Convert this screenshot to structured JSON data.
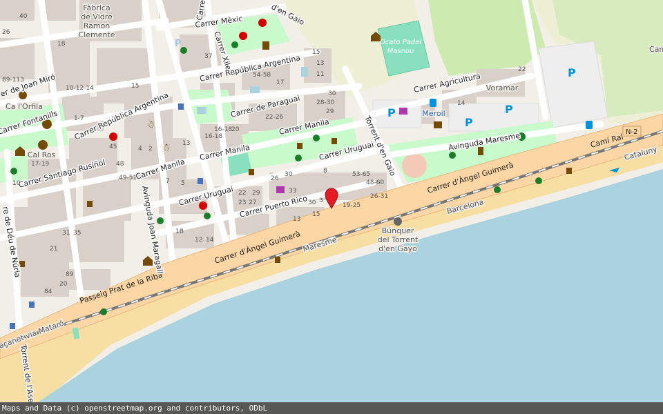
{
  "map": {
    "streets": {
      "carrer_mexic": "Carrer Mèxic",
      "carrer_xile_top": "Carrer Xile",
      "carrer_xile": "Carrer Xile",
      "carrer_rep_arg_top": "Carrer República Argentina",
      "carrer_rep_arg_left": "Carrer República Argentina",
      "carrer_paraguai": "Carrer de Paraguai",
      "carrer_manila_right": "Carrer Manila",
      "carrer_manila_mid": "Carrer Manila",
      "carrer_manila_left": "Carrer Manila",
      "carrer_uruguai_right": "Carrer Uruguai",
      "carrer_uruguai_left": "Carrer Uruguai",
      "carrer_puerto_rico": "Carrer Puerto Rico",
      "carrer_agricultura": "Carrer Agricultura",
      "avinguda_maresme": "Avinguda Maresme",
      "torrent_den_gaio": "Torrent d'en Gaio",
      "torrent_den_gaio_top": "d'en Gaio",
      "carrer_angel_guimera_right": "Carrer d'Àngel Guimerà",
      "carrer_angel_guimera_left": "Carrer d'Àngel Guimerà",
      "cami_ral": "Camí Ral",
      "passeig_prat": "Passeig Prat de la Riba",
      "carrer_santiago_rusinol": "Carrer Santiago Rusiñol",
      "carrer_fontanills": "Carrer Fontanills",
      "carrer_joan_miro": "er de Joan Miró",
      "avinguda_joan_maragall": "Avinguda Joan Maragall",
      "deu_de_nuria": "re de Déu de Núria",
      "torrent_de_lase": "Torrent de l'Ase",
      "cataluny": "Cataluny",
      "maresme_rail": "Maresme",
      "barcelona_rail": "Barcelona",
      "acanet_via_mataro": "açanet via Mataró"
    },
    "pois": {
      "fabrica_line1": "Fàbrica",
      "fabrica_line2": "de Vidre",
      "fabrica_line3": "Ramon",
      "fabrica_line4": "Clemente",
      "cal_orfila": "Ca l'Orfila",
      "cal_ros": "Cal Ros",
      "ocato_line1": "Ocato Padel",
      "ocato_line2": "Masnou",
      "meroil": "Meroil",
      "voramar": "Voramar",
      "bunquer_line1": "Búnquer",
      "bunquer_line2": "del Torrent",
      "bunquer_line3": "d'en Gayo",
      "cam": "Cam"
    },
    "shield": "N-2",
    "house_numbers": {
      "n1": "40",
      "n2": "26",
      "n3": "18",
      "n4": "89-113",
      "n5": "10-12-14",
      "n6": "15",
      "n7": "1-7",
      "n8": "45",
      "n9": "37",
      "n10": "54-58",
      "n11": "17",
      "n12": "15",
      "n13": "13",
      "n14": "11",
      "n15": "30",
      "n16": "28-30",
      "n17": "29",
      "n18": "22-26",
      "n19": "16-18",
      "n20": "20",
      "n21": "16-18",
      "n22": "22",
      "n23": "14",
      "n24": "53-65",
      "n25": "48-60",
      "n26": "26-31",
      "n27": "19-25",
      "n28": "8",
      "n29": "33",
      "n30": "30",
      "n31": "26",
      "n32": "22",
      "n33": "29",
      "n34": "23",
      "n35": "27",
      "n36": "15",
      "n37": "13",
      "n38": "1B",
      "n39": "12",
      "n40": "14",
      "n41": "48",
      "n42": "49-51",
      "n43": "17-19",
      "n44": "35",
      "n45": "31",
      "n46": "21",
      "n47": "89",
      "n48": "20",
      "n49": "84",
      "n50": "4",
      "n51": "2",
      "n52": "10",
      "n53": "13",
      "n54": "30",
      "n55": "3",
      "n56": "7",
      "n57": "5"
    },
    "colors": {
      "background": "#f2efe9",
      "sea": "#aad3df",
      "beach": "#f7dea2",
      "major_road": "#fcd6a4",
      "park": "#c8facc",
      "grass": "#cdebb0",
      "building": "#d9d0c9",
      "parking": "#eeeeee",
      "pitch": "#88e0be",
      "marker": "#e51b23"
    },
    "marker": {
      "icon": "map-pin-marker-icon"
    }
  },
  "attribution": "Maps and Data (c) openstreetmap.org and contributors, ODbL"
}
